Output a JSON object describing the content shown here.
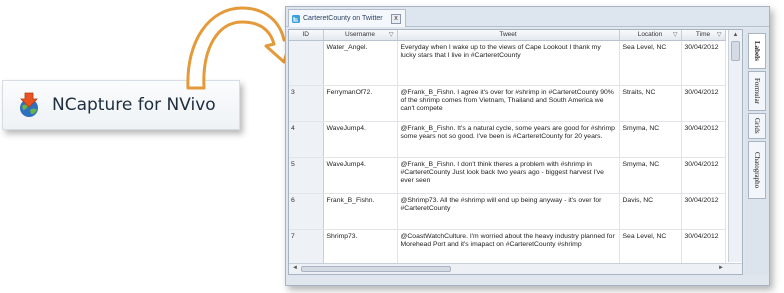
{
  "ncapture": {
    "label": "NCapture for NVivo",
    "icon": "ncapture-download-globe-icon"
  },
  "window": {
    "tab_title": "CarteretCounty on Twitter",
    "tab_close": "x",
    "tab_icon": "twitter-icon"
  },
  "table": {
    "columns": {
      "id": "ID",
      "username": "Username",
      "tweet": "Tweet",
      "location": "Location",
      "time": "Time"
    },
    "rows": [
      {
        "id": "",
        "username": "Water_Angel.",
        "tweet": "Everyday when I wake up to the views of Cape Lookout I thank my lucky stars that I live in #CarteretCounty",
        "location": "Sea Level, NC",
        "time": "30/04/2012"
      },
      {
        "id": "3",
        "username": "FerrymanOf72.",
        "tweet": "@Frank_B_Fishn. I agree it's over for #shrimp in #CarteretCounty 90% of the shrimp comes from Vietnam, Thailand and South America we can't compete",
        "location": "Straits, NC",
        "time": "30/04/2012"
      },
      {
        "id": "4",
        "username": "WaveJump4.",
        "tweet": "@Frank_B_Fishn. It's a natural cycle, some years are good for #shrimp some years not so good. I've been is #CarteretCounty for 20 years.",
        "location": "Smyma, NC",
        "time": "30/04/2012"
      },
      {
        "id": "5",
        "username": "WaveJump4.",
        "tweet": "@Frank_B_Fishn. I don't think theres a problem with #shrimp in #CarteretCounty Just look back two years ago - biggest harvest I've ever seen",
        "location": "Smyma, NC",
        "time": "30/04/2012"
      },
      {
        "id": "6",
        "username": "Frank_B_Fishn.",
        "tweet": "@Shrimp73. All the #shrimp will end up being anyway - it's over for #CarteretCounty",
        "location": "Davis, NC",
        "time": "30/04/2012"
      },
      {
        "id": "7",
        "username": "Shrimp73.",
        "tweet": "@CoastWatchCulture. I'm worried about the heavy industry planned for Morehead Port and it's imapact on #CarteretCounty #shrimp",
        "location": "Sea Level, NC",
        "time": "30/04/2012"
      }
    ]
  },
  "side_tabs": [
    "Labels",
    "Formular",
    "Grids",
    "Chatographo"
  ],
  "colors": {
    "arrow_fill": "#ffffff",
    "arrow_stroke": "#e59a3a",
    "window_bg": "#dfe6ee"
  }
}
